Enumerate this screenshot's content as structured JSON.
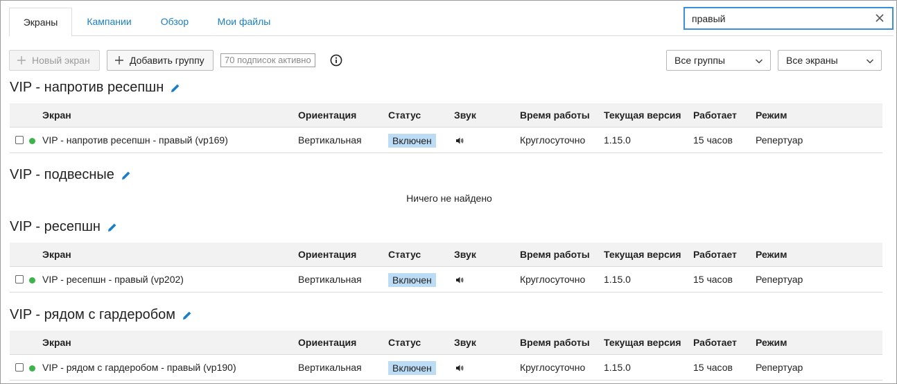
{
  "tabs": [
    {
      "label": "Экраны",
      "active": true
    },
    {
      "label": "Кампании",
      "active": false
    },
    {
      "label": "Обзор",
      "active": false
    },
    {
      "label": "Мои файлы",
      "active": false
    }
  ],
  "search": {
    "value": "правый"
  },
  "toolbar": {
    "new_screen_label": "Новый экран",
    "add_group_label": "Добавить группу",
    "subscriptions_badge": "70 подписок активно"
  },
  "filters": {
    "groups_selected": "Все группы",
    "screens_selected": "Все экраны"
  },
  "columns": [
    "Экран",
    "Ориентация",
    "Статус",
    "Звук",
    "Время работы",
    "Текущая версия",
    "Работает",
    "Режим"
  ],
  "groups": [
    {
      "title": "VIP - напротив ресепшн",
      "rows": [
        {
          "screen": "VIP - напротив ресепшн - правый (vp169)",
          "orientation": "Вертикальная",
          "status": "Включен",
          "uptime_mode": "Круглосуточно",
          "version": "1.15.0",
          "running": "15 часов",
          "mode": "Репертуар"
        }
      ]
    },
    {
      "title": "VIP - подвесные",
      "empty_text": "Ничего не найдено",
      "rows": []
    },
    {
      "title": "VIP - ресепшн",
      "rows": [
        {
          "screen": "VIP - ресепшн - правый (vp202)",
          "orientation": "Вертикальная",
          "status": "Включен",
          "uptime_mode": "Круглосуточно",
          "version": "1.15.0",
          "running": "15 часов",
          "mode": "Репертуар"
        }
      ]
    },
    {
      "title": "VIP - рядом с гардеробом",
      "rows": [
        {
          "screen": "VIP - рядом с гардеробом - правый (vp190)",
          "orientation": "Вертикальная",
          "status": "Включен",
          "uptime_mode": "Круглосуточно",
          "version": "1.15.0",
          "running": "15 часов",
          "mode": "Репертуар"
        }
      ]
    }
  ],
  "colors": {
    "accent": "#1a7fc8",
    "status_pill": "#bcdcf5",
    "online_dot": "#3bb54a"
  }
}
